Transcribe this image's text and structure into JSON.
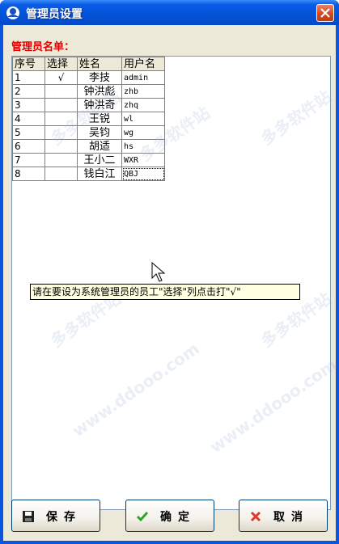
{
  "window": {
    "title": "管理员设置"
  },
  "list_title": "管理员名单：",
  "table": {
    "headers": {
      "no": "序号",
      "select": "选择",
      "name": "姓名",
      "user": "用户名"
    },
    "rows": [
      {
        "no": "1",
        "select": "√",
        "name": "李技",
        "user": "admin"
      },
      {
        "no": "2",
        "select": "",
        "name": "钟洪彪",
        "user": "zhb"
      },
      {
        "no": "3",
        "select": "",
        "name": "钟洪奇",
        "user": "zhq"
      },
      {
        "no": "4",
        "select": "",
        "name": "王锐",
        "user": "wl"
      },
      {
        "no": "5",
        "select": "",
        "name": "吴钧",
        "user": "wg"
      },
      {
        "no": "6",
        "select": "",
        "name": "胡适",
        "user": "hs"
      },
      {
        "no": "7",
        "select": "",
        "name": "王小二",
        "user": "WXR"
      },
      {
        "no": "8",
        "select": "",
        "name": "钱白江",
        "user": "QBJ"
      }
    ]
  },
  "tooltip": "请在要设为系统管理员的员工\"选择\"列点击打\"√\"",
  "buttons": {
    "save": "保存",
    "ok": "确定",
    "cancel": "取消"
  },
  "watermark": {
    "site": "www.ddooo.com",
    "brand": "多多软件站"
  }
}
